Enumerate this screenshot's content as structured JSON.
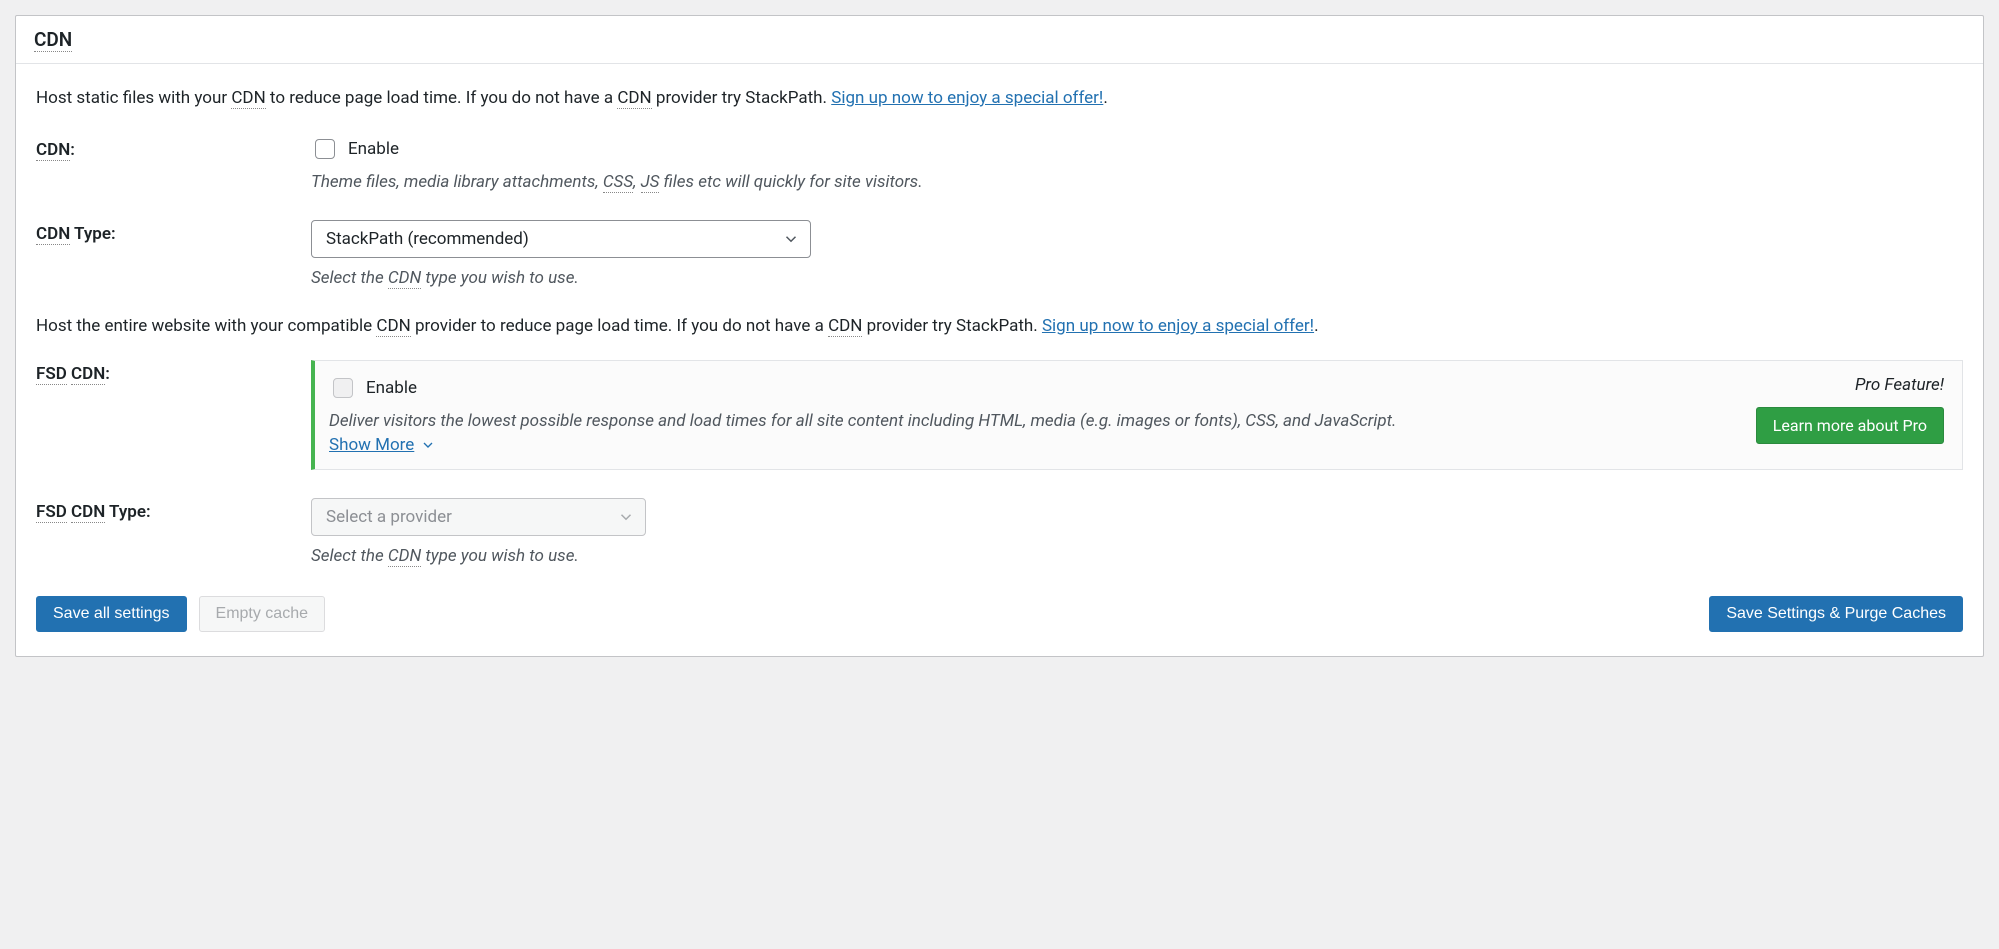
{
  "header": {
    "title": "CDN"
  },
  "intro": {
    "part1": "Host static files with your ",
    "cdn_abbr": "CDN",
    "part2": " to reduce page load time. If you do not have a ",
    "part3": " provider try StackPath. ",
    "link": "Sign up now to enjoy a special offer!",
    "period": "."
  },
  "cdn_row": {
    "label_abbr": "CDN",
    "label_suffix": ":",
    "enable_label": "Enable",
    "desc_part1": "Theme files, media library attachments, ",
    "css_abbr": "CSS",
    "comma_space": ", ",
    "js_abbr": "JS",
    "desc_part2": " files etc will quickly for site visitors."
  },
  "cdn_type_row": {
    "label_abbr": "CDN",
    "label_suffix": " Type:",
    "selected": "StackPath (recommended)",
    "desc_part1": "Select the ",
    "desc_abbr": "CDN",
    "desc_part2": " type you wish to use."
  },
  "section2": {
    "part1": "Host the entire website with your compatible ",
    "part2": " provider to reduce page load time. If you do not have a ",
    "part3": " provider try StackPath. ",
    "link": "Sign up now to enjoy a special offer!",
    "period": "."
  },
  "fsd_row": {
    "label_fsd": "FSD",
    "label_cdn": "CDN",
    "label_suffix": ":",
    "enable_label": "Enable",
    "desc": "Deliver visitors the lowest possible response and load times for all site content including HTML, media (e.g. images or fonts), CSS, and JavaScript.",
    "show_more": "Show More",
    "pro_feature": "Pro Feature!",
    "learn_more": "Learn more about Pro"
  },
  "fsd_type_row": {
    "label_fsd": "FSD",
    "label_cdn": "CDN",
    "label_suffix": " Type:",
    "placeholder": "Select a provider",
    "desc_part1": "Select the ",
    "desc_abbr": "CDN",
    "desc_part2": " type you wish to use."
  },
  "actions": {
    "save_all": "Save all settings",
    "empty_cache": "Empty cache",
    "save_purge": "Save Settings & Purge Caches"
  }
}
